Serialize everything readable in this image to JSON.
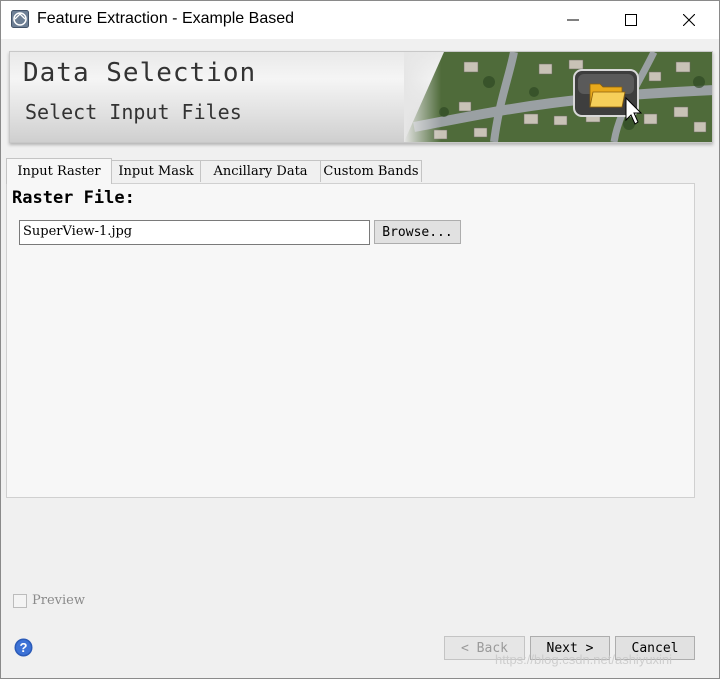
{
  "window": {
    "title": "Feature Extraction - Example Based",
    "controls": {
      "minimize_icon": "minimize-icon",
      "maximize_icon": "maximize-icon",
      "close_icon": "close-icon"
    }
  },
  "banner": {
    "title": "Data Selection",
    "subtitle": "Select Input Files",
    "image": "aerial-neighborhood-folder-image"
  },
  "tabs": [
    {
      "label": "Input Raster",
      "active": true
    },
    {
      "label": "Input Mask",
      "active": false
    },
    {
      "label": "Ancillary Data",
      "active": false
    },
    {
      "label": "Custom Bands",
      "active": false
    }
  ],
  "raster": {
    "label": "Raster File:",
    "value": "SuperView-1.jpg",
    "browse_label": "Browse..."
  },
  "preview": {
    "label": "Preview",
    "checked": false
  },
  "footer": {
    "back_label": "< Back",
    "next_label": "Next >",
    "cancel_label": "Cancel",
    "watermark": "https://blog.csdn.net/ashiyuxini"
  },
  "colors": {
    "help": "#2b5bb8",
    "panel": "#f7f7f7"
  }
}
